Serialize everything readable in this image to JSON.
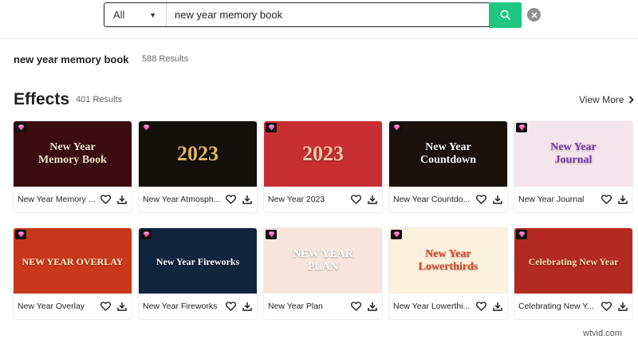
{
  "search": {
    "category": "All",
    "query": "new year memory book",
    "placeholder": ""
  },
  "results": {
    "query": "new year memory book",
    "count": "588 Results"
  },
  "section": {
    "title": "Effects",
    "count": "401 Results",
    "view_more": "View More"
  },
  "cards": [
    {
      "name": "New Year Memory ...",
      "thumb_text": "New Year\nMemory Book",
      "bg": "#3a0d10",
      "color": "#f3e2c8"
    },
    {
      "name": "New Year Atmosph...",
      "thumb_text": "2023",
      "bg": "#14110c",
      "color": "#e6b65a"
    },
    {
      "name": "New Year 2023",
      "thumb_text": "2023",
      "bg": "#c72f33",
      "color": "#f2c9a6"
    },
    {
      "name": "New Year Countdo...",
      "thumb_text": "New Year\nCountdown",
      "bg": "#1b120e",
      "color": "#ffffff"
    },
    {
      "name": "New Year Journal",
      "thumb_text": "New Year\nJournal",
      "bg": "#f6e4ec",
      "color": "#7b3fb0"
    },
    {
      "name": "New Year Overlay",
      "thumb_text": "NEW YEAR OVERLAY",
      "bg": "#c9381c",
      "color": "#fff3cc"
    },
    {
      "name": "New Year Fireworks",
      "thumb_text": "New Year Fireworks",
      "bg": "#12253f",
      "color": "#ffffff"
    },
    {
      "name": "New Year Plan",
      "thumb_text": "NEW YEAR\nPLAN",
      "bg": "#f7e5dc",
      "color": "#ffffff"
    },
    {
      "name": "New Year Lowerthi...",
      "thumb_text": "New Year\nLowerthirds",
      "bg": "#fbf1dc",
      "color": "#d8452b"
    },
    {
      "name": "Celebrating New Y...",
      "thumb_text": "Celebrating New Year",
      "bg": "#b32a22",
      "color": "#f8e2a8"
    }
  ],
  "icons": {
    "gem": "gem-icon",
    "like": "heart-icon",
    "download": "download-icon",
    "search": "search-icon",
    "clear": "close-icon",
    "view_more": "chevron-right-icon"
  },
  "colors": {
    "accent": "#1fc782",
    "gem": "#ff5fae"
  },
  "watermark": "wtvid.com"
}
